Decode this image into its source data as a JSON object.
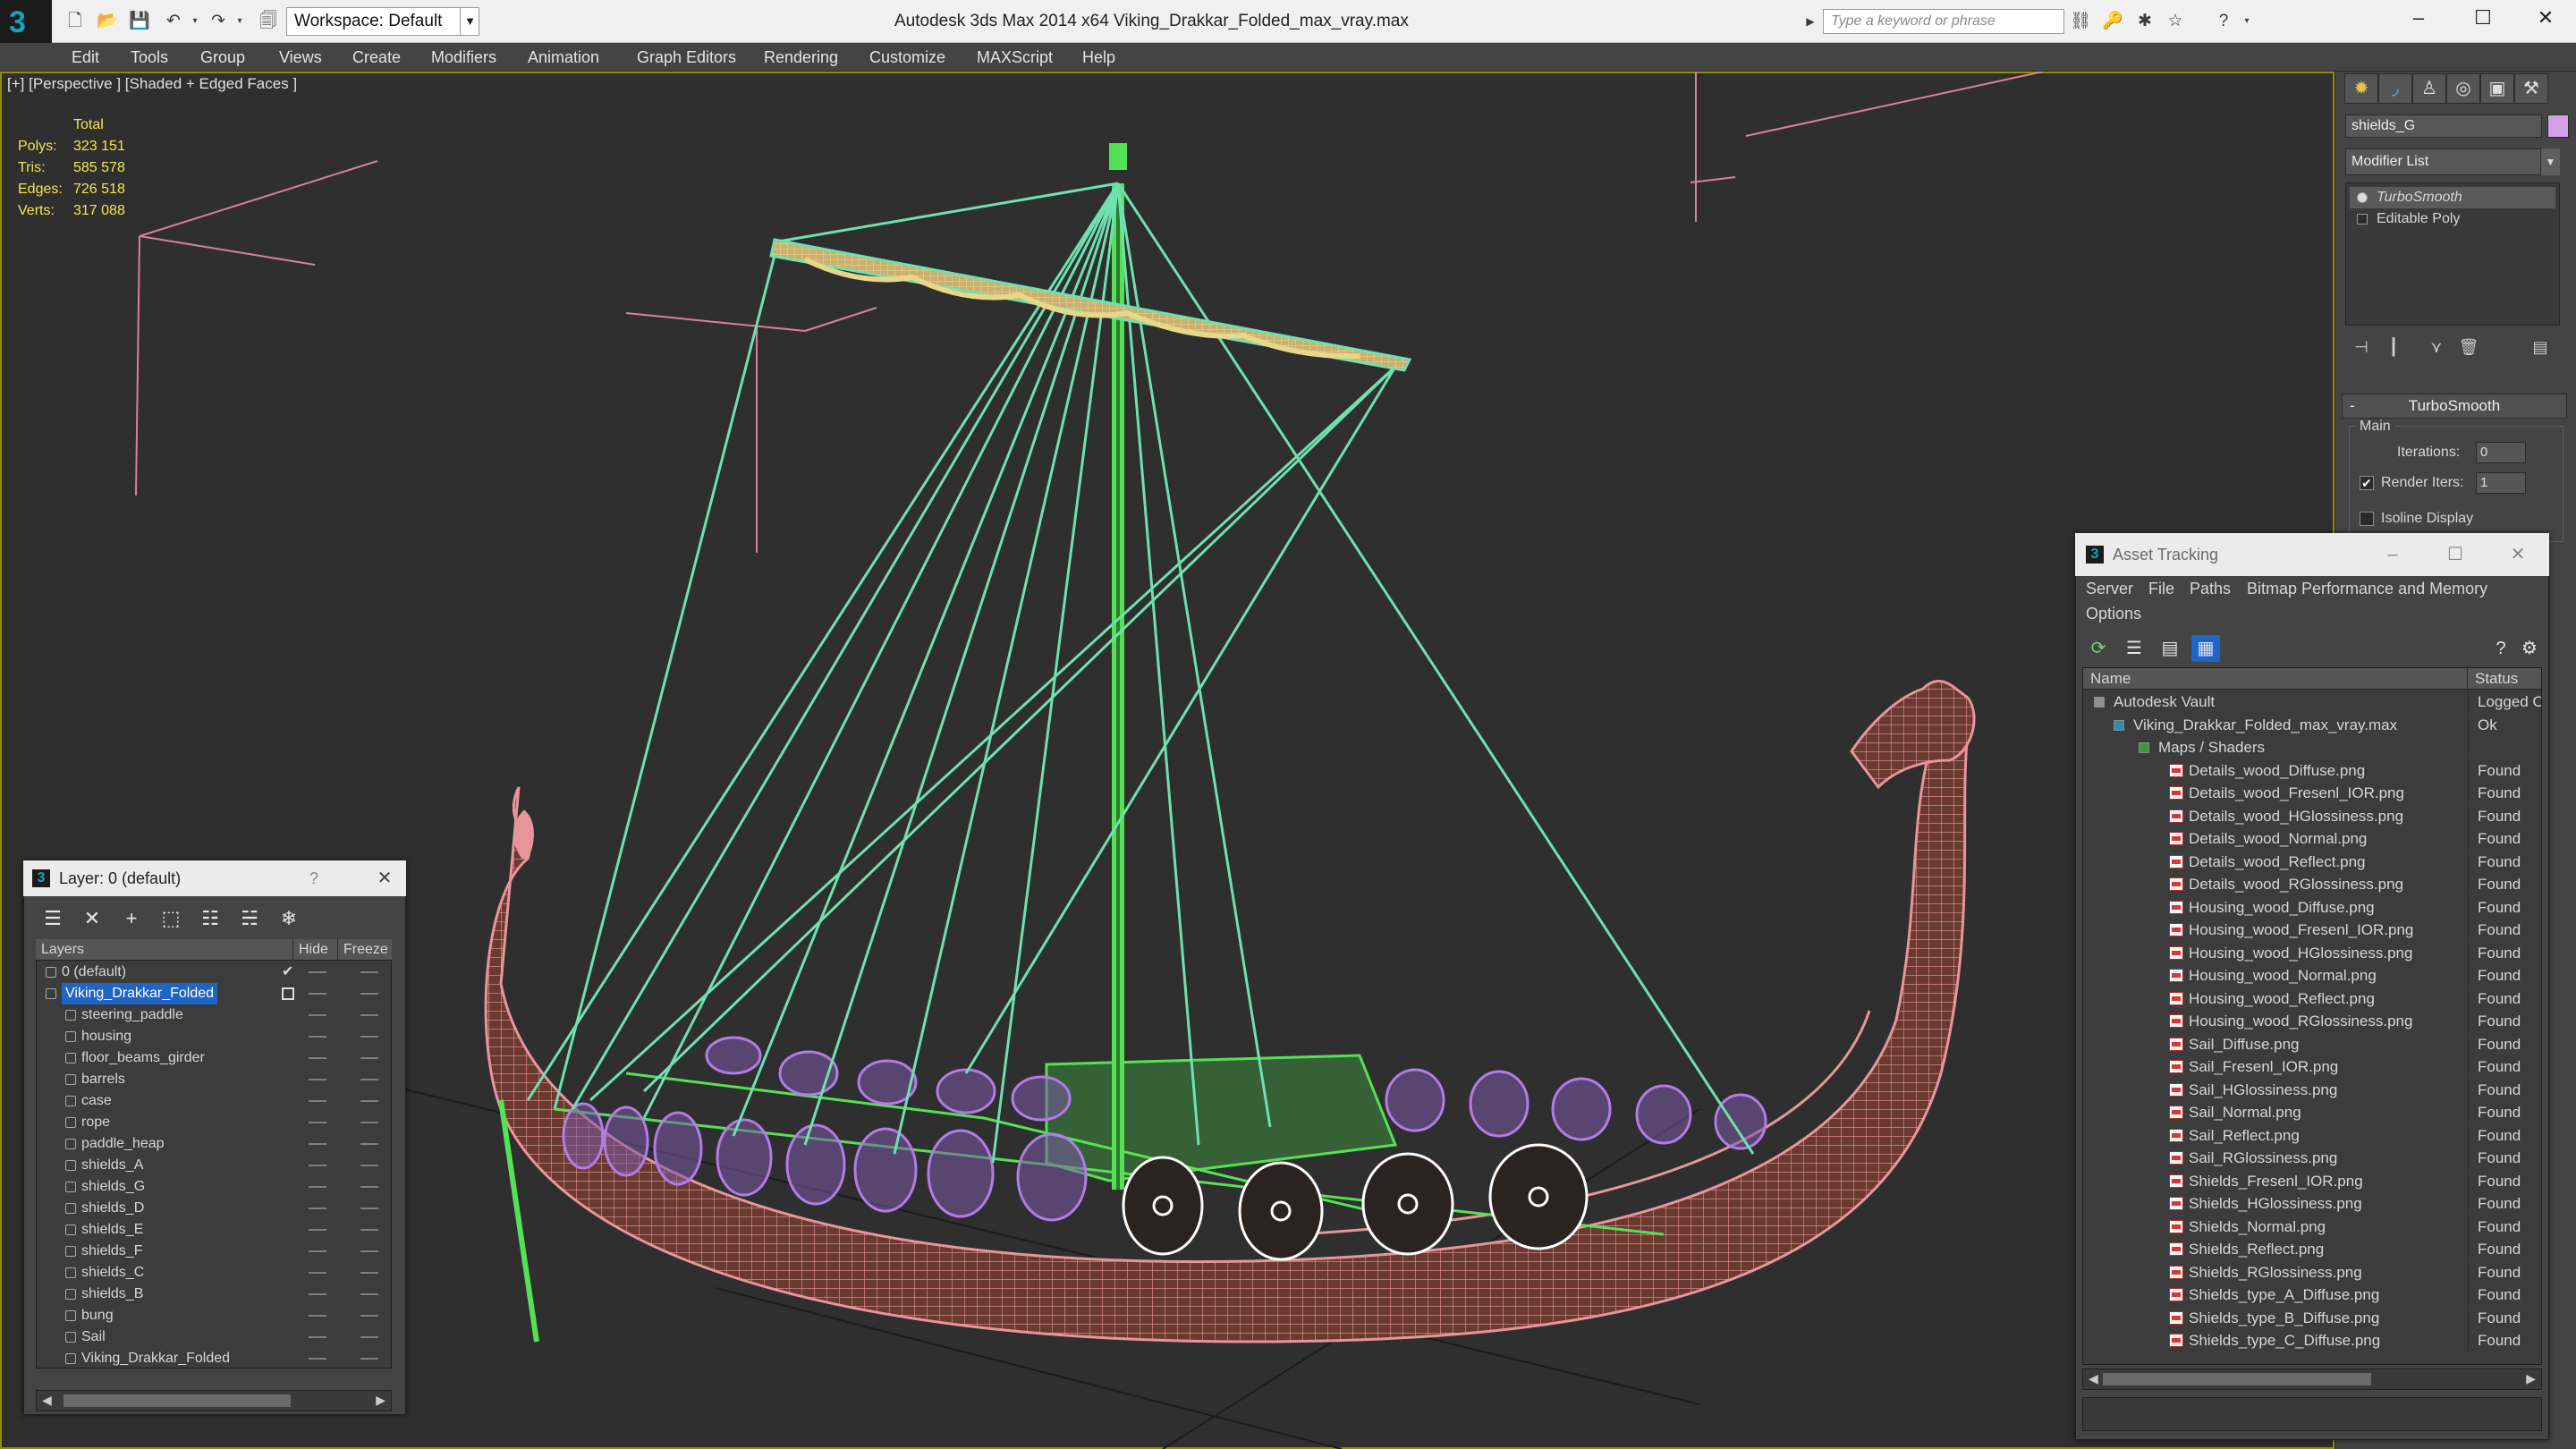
{
  "titlebar": {
    "workspace_label": "Workspace: Default",
    "app_title": "Autodesk 3ds Max  2014 x64       Viking_Drakkar_Folded_max_vray.max",
    "search_placeholder": "Type a keyword or phrase"
  },
  "menu": [
    "Edit",
    "Tools",
    "Group",
    "Views",
    "Create",
    "Modifiers",
    "Animation",
    "Graph Editors",
    "Rendering",
    "Customize",
    "MAXScript",
    "Help"
  ],
  "viewport": {
    "label": "[+] [Perspective ] [Shaded + Edged Faces ]",
    "stats": {
      "header": "Total",
      "rows": [
        {
          "key": "Polys:",
          "value": "323 151"
        },
        {
          "key": "Tris:",
          "value": "585 578"
        },
        {
          "key": "Edges:",
          "value": "726 518"
        },
        {
          "key": "Verts:",
          "value": "317 088"
        }
      ]
    }
  },
  "command_panel": {
    "object_name": "shields_G",
    "object_color": "#d3a0e8",
    "modifier_list_label": "Modifier List",
    "stack": [
      "TurboSmooth",
      "Editable Poly"
    ],
    "rollout_title": "TurboSmooth",
    "group_main": "Main",
    "iterations_label": "Iterations:",
    "iterations_value": "0",
    "render_iters_label": "Render Iters:",
    "render_iters_value": "1",
    "render_iters_checked": "✔",
    "isoline_label": "Isoline Display"
  },
  "layer_dialog": {
    "title": "Layer: 0 (default)",
    "help": "?",
    "columns": [
      "Layers",
      "Hide",
      "Freeze"
    ],
    "rows": [
      {
        "name": "0 (default)",
        "level": 0,
        "checked": "✔"
      },
      {
        "name": "Viking_Drakkar_Folded",
        "level": 0,
        "selected": true
      },
      {
        "name": "steering_paddle",
        "level": 1
      },
      {
        "name": "housing",
        "level": 1
      },
      {
        "name": "floor_beams_girder",
        "level": 1
      },
      {
        "name": "barrels",
        "level": 1
      },
      {
        "name": "case",
        "level": 1
      },
      {
        "name": "rope",
        "level": 1
      },
      {
        "name": "paddle_heap",
        "level": 1
      },
      {
        "name": "shields_A",
        "level": 1
      },
      {
        "name": "shields_G",
        "level": 1
      },
      {
        "name": "shields_D",
        "level": 1
      },
      {
        "name": "shields_E",
        "level": 1
      },
      {
        "name": "shields_F",
        "level": 1
      },
      {
        "name": "shields_C",
        "level": 1
      },
      {
        "name": "shields_B",
        "level": 1
      },
      {
        "name": "bung",
        "level": 1
      },
      {
        "name": "Sail",
        "level": 1
      },
      {
        "name": "Viking_Drakkar_Folded",
        "level": 1
      }
    ]
  },
  "asset_tracking": {
    "title": "Asset Tracking",
    "menu": [
      "Server",
      "File",
      "Paths",
      "Bitmap Performance and Memory",
      "Options"
    ],
    "columns": [
      "Name",
      "Status"
    ],
    "rows": [
      {
        "name": "Autodesk Vault",
        "status": "Logged O",
        "level": 0,
        "kind": "vault"
      },
      {
        "name": "Viking_Drakkar_Folded_max_vray.max",
        "status": "Ok",
        "level": 1,
        "kind": "max"
      },
      {
        "name": "Maps / Shaders",
        "status": "",
        "level": 2,
        "kind": "maps"
      },
      {
        "name": "Details_wood_Diffuse.png",
        "status": "Found",
        "level": 3,
        "kind": "png"
      },
      {
        "name": "Details_wood_Fresenl_IOR.png",
        "status": "Found",
        "level": 3,
        "kind": "png"
      },
      {
        "name": "Details_wood_HGlossiness.png",
        "status": "Found",
        "level": 3,
        "kind": "png"
      },
      {
        "name": "Details_wood_Normal.png",
        "status": "Found",
        "level": 3,
        "kind": "png"
      },
      {
        "name": "Details_wood_Reflect.png",
        "status": "Found",
        "level": 3,
        "kind": "png"
      },
      {
        "name": "Details_wood_RGlossiness.png",
        "status": "Found",
        "level": 3,
        "kind": "png"
      },
      {
        "name": "Housing_wood_Diffuse.png",
        "status": "Found",
        "level": 3,
        "kind": "png"
      },
      {
        "name": "Housing_wood_Fresenl_IOR.png",
        "status": "Found",
        "level": 3,
        "kind": "png"
      },
      {
        "name": "Housing_wood_HGlossiness.png",
        "status": "Found",
        "level": 3,
        "kind": "png"
      },
      {
        "name": "Housing_wood_Normal.png",
        "status": "Found",
        "level": 3,
        "kind": "png"
      },
      {
        "name": "Housing_wood_Reflect.png",
        "status": "Found",
        "level": 3,
        "kind": "png"
      },
      {
        "name": "Housing_wood_RGlossiness.png",
        "status": "Found",
        "level": 3,
        "kind": "png"
      },
      {
        "name": "Sail_Diffuse.png",
        "status": "Found",
        "level": 3,
        "kind": "png"
      },
      {
        "name": "Sail_Fresenl_IOR.png",
        "status": "Found",
        "level": 3,
        "kind": "png"
      },
      {
        "name": "Sail_HGlossiness.png",
        "status": "Found",
        "level": 3,
        "kind": "png"
      },
      {
        "name": "Sail_Normal.png",
        "status": "Found",
        "level": 3,
        "kind": "png"
      },
      {
        "name": "Sail_Reflect.png",
        "status": "Found",
        "level": 3,
        "kind": "png"
      },
      {
        "name": "Sail_RGlossiness.png",
        "status": "Found",
        "level": 3,
        "kind": "png"
      },
      {
        "name": "Shields_Fresenl_IOR.png",
        "status": "Found",
        "level": 3,
        "kind": "png"
      },
      {
        "name": "Shields_HGlossiness.png",
        "status": "Found",
        "level": 3,
        "kind": "png"
      },
      {
        "name": "Shields_Normal.png",
        "status": "Found",
        "level": 3,
        "kind": "png"
      },
      {
        "name": "Shields_Reflect.png",
        "status": "Found",
        "level": 3,
        "kind": "png"
      },
      {
        "name": "Shields_RGlossiness.png",
        "status": "Found",
        "level": 3,
        "kind": "png"
      },
      {
        "name": "Shields_type_A_Diffuse.png",
        "status": "Found",
        "level": 3,
        "kind": "png"
      },
      {
        "name": "Shields_type_B_Diffuse.png",
        "status": "Found",
        "level": 3,
        "kind": "png"
      },
      {
        "name": "Shields_type_C_Diffuse.png",
        "status": "Found",
        "level": 3,
        "kind": "png"
      }
    ]
  },
  "colors": {
    "viewport_border": "#8f8f00",
    "stats_text": "#f2e64a",
    "hull_wire": "#e7959b",
    "mast_wire": "#6fe0b0",
    "shield_wire": "#b27be6",
    "deck_wire": "#54e254",
    "selection": "#1f64c7"
  }
}
